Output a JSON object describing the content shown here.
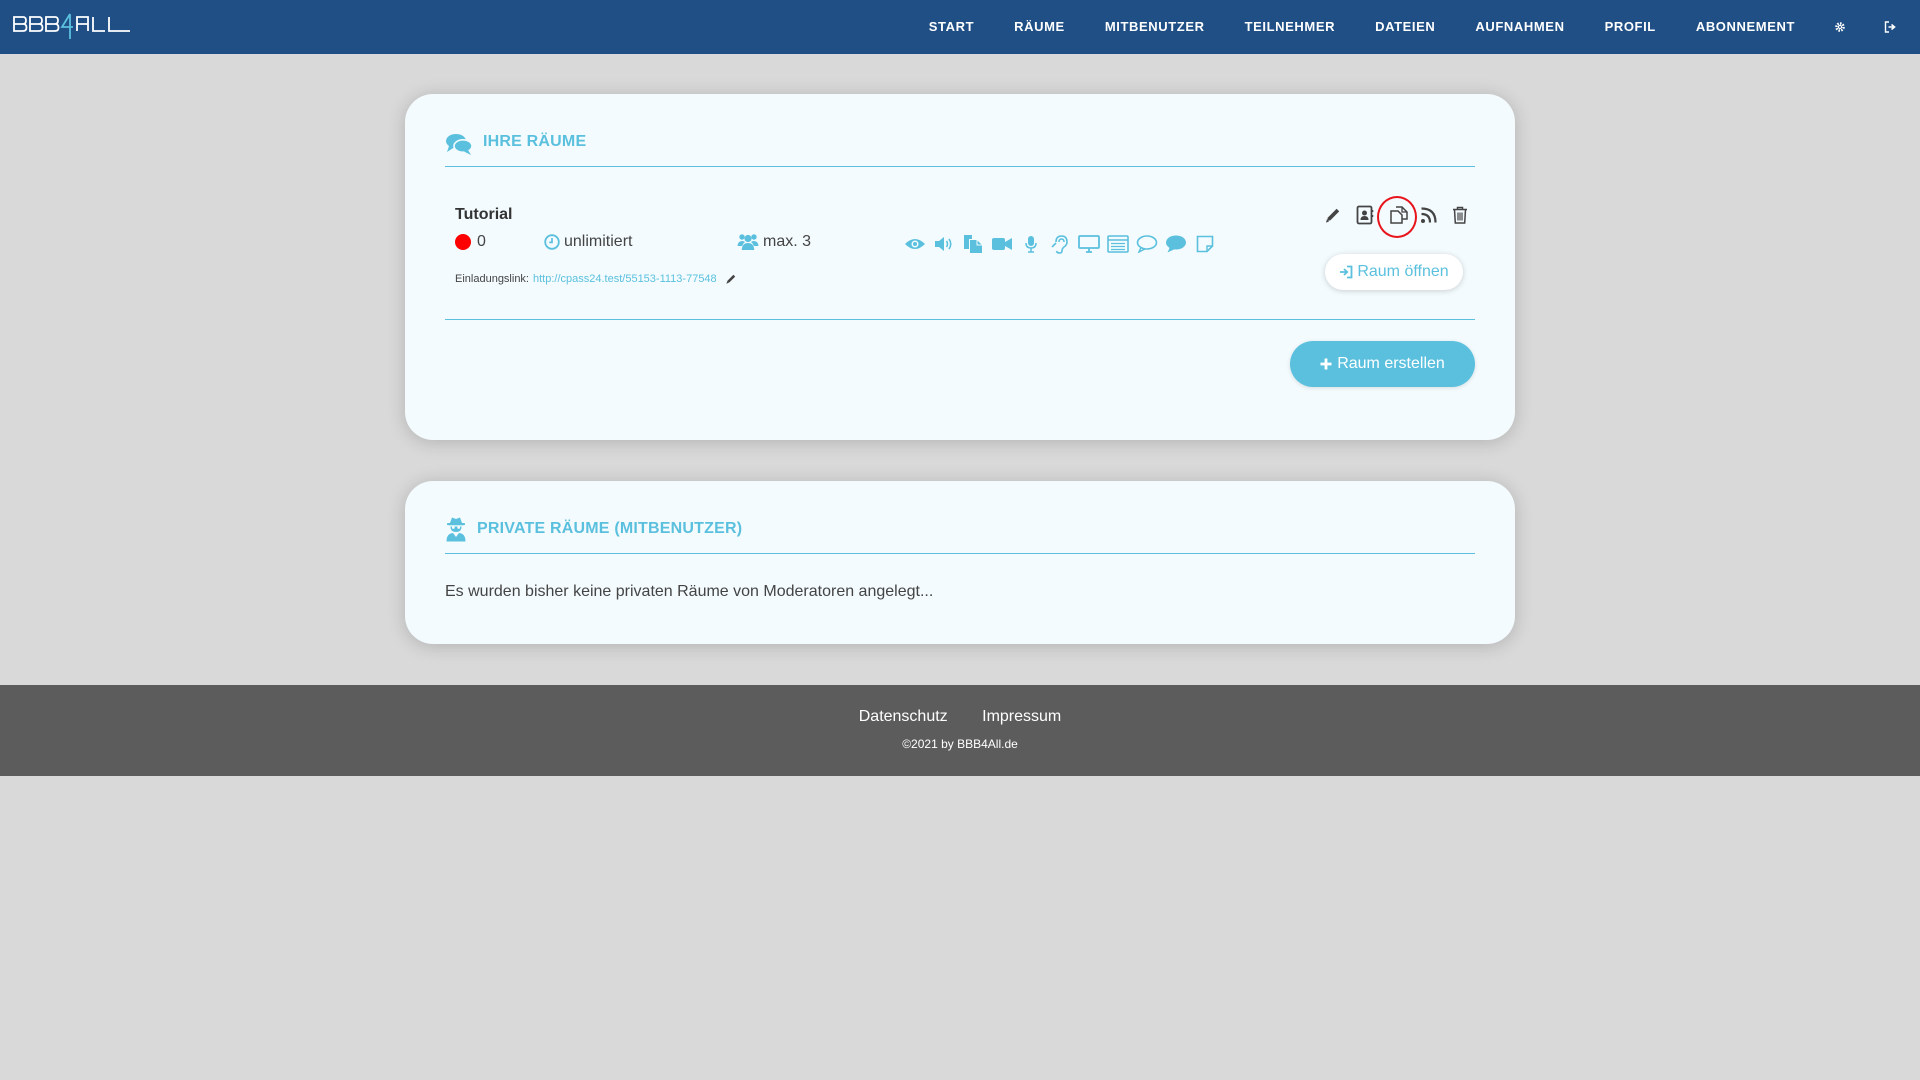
{
  "app": {
    "logo_text": "BBB4ALL"
  },
  "nav": {
    "items": [
      "START",
      "RÄUME",
      "MITBENUTZER",
      "TEILNEHMER",
      "DATEIEN",
      "AUFNAHMEN",
      "PROFIL",
      "ABONNEMENT"
    ],
    "icons": [
      "gear-icon",
      "logout-icon"
    ]
  },
  "rooms_card": {
    "title": "IHRE RÄUME",
    "icon": "comments-icon",
    "room": {
      "name": "Tutorial",
      "participants": "0",
      "duration": "unlimitiert",
      "max_users": "max. 3",
      "invite_label": "Einladungslink:",
      "invite_url": "http://cpass24.test/55153-1113-77548",
      "feature_icons": [
        "eye-icon",
        "volume-icon",
        "copy-files-icon",
        "video-camera-icon",
        "microphone-icon",
        "hearing-icon",
        "monitor-icon",
        "list-window-icon",
        "chat-outline-icon",
        "chat-filled-icon",
        "note-icon"
      ],
      "action_icons": [
        "edit-icon",
        "contact-card-icon",
        "duplicate-icon",
        "rss-icon",
        "trash-icon"
      ],
      "open_button": "Raum öffnen"
    },
    "create_button": "Raum erstellen"
  },
  "private_card": {
    "title": "PRIVATE RÄUME (MITBENUTZER)",
    "icon": "user-secret-icon",
    "empty_text": "Es wurden bisher keine privaten Räume von Moderatoren angelegt..."
  },
  "footer": {
    "links": [
      "Datenschutz",
      "Impressum"
    ],
    "copyright": "©2021 by BBB4All.de"
  },
  "colors": {
    "nav_bg": "#1f4f85",
    "accent": "#5bc0de",
    "footer_bg": "#5c5c5c",
    "status_red": "#ff0000"
  }
}
